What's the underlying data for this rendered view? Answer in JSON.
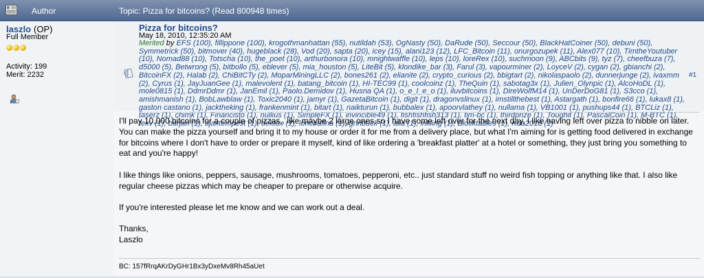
{
  "header": {
    "author_label": "Author",
    "topic_text": "Topic: Pizza for bitcoins?  (Read 800948 times)"
  },
  "user": {
    "name": "laszlo",
    "op": "(OP)",
    "rank": "Full Member",
    "activity": "Activity: 199",
    "merit": "Merit: 2232"
  },
  "post": {
    "title": "Pizza for bitcoins?",
    "date": "May 18, 2010, 12:35:20 AM",
    "merited_label": "Merited",
    "by_label": "by",
    "merits_rest": "EFS (100), fillippone (100), krogothmanhattan (55), nutildah (53), OgNasty (50), DaRude (50), Seccour (50), BlackHatCoiner (50), debuni (50), Symmetrick (50), bitmover (40), hugeblack (28), Vod (20), sapta (20), icey (15), alani123 (12), LFC_Bitcoin (11), onurgozupek (11), Alex077 (10), TimtheYoutuber (10), Nomad88 (10), Totscha (10), the_poet (10), arthurbonora (10), mnightwaffle (10), leps (10), loreRex (10), suchmoon (9), ABCbits (9), tyz (7), cheefbuza (7), d5000 (5), Betwrong (5), bitbollo (5), eblever (5), mia_houston (5), LiteBit (5), klondike_bar (3), Farul (3), vapourminer (2), LoyceV (2), cygan (2), gbianchi (2), BitcoinFX (2), Halab (2), ChiBitCTy (2), MoparMiningLLC (2), bones261 (2), elianite (2), crypto_curious (2), bbigtart (2), nikolaspaolo (2), dunnerjunge (2), ivaxmm (2), Cyrus (1), JayJuanGee (1), malevolent (1), batang_bitcoin (1), HI-TEC99 (1), coolcoinz (1), TheQuin (1), sabotag3x (1), Julien_Olynpic (1), AlcoHoDL (1), mole0815 (1), DdmrDdmr (1), JanEmil (1), Paolo.Demidov (1), Husna QA (1), o_e_l_e_o (1), iluvbitcoins (1), DireWolfM14 (1), UnDerDoG81 (1), S3cco (1), amishmanish (1), BobLawblaw (1), Toxic2040 (1), jamyr (1), GazetaBitcoin (1), digit (1), dragonvslinux (1), imstillthebest (1), Astargath (1), bonfire66 (1), lukax8 (1), gaston castano (1), jacktheking (1), frankenmint (1), bitart (1), naikturun (1), bubbalex (1), apoorvlathey (1), nullama (1), VB1001 (1), pushups44 (1), BTCLiz (1), taserz (1), chimk (1), Financisto (1), nullius (1), SimpleFX (1), invincible49 (1), fishfishfish313 (1), tim-bc (1), thirdprize (1), Toughit (1), PascalCoin (1), M-BTC (1), texv (1), barjan (1), ajaxtempest (1), dektox (1), lonchafina (1), grinbuck (1), alia (1), inkling (1), Blocktables (1), Kda2018 (1)",
    "number": "#1",
    "body": [
      "I'll pay 10,000 bitcoins for a couple of pizzas.. like maybe 2 large ones so I have some left over for the next day.  I like having left over pizza to nibble on later.  You can make the pizza yourself and bring it to my house or order it for me from a delivery place, but what I'm aiming for is getting food delivered in exchange for bitcoins where I don't have to order or prepare it myself, kind of like ordering a 'breakfast platter' at a hotel or something, they just bring you something to eat and you're happy!",
      "I like things like onions, peppers, sausage, mushrooms, tomatoes, pepperoni, etc.. just standard stuff no weird fish topping or anything like that.  I also like regular cheese pizzas which may be cheaper to prepare or otherwise acquire.",
      "If you're interested please let me know and we can work out a deal.",
      "Thanks,",
      "Laszlo"
    ],
    "signature": "BC: 157fRrqAKrDyGHr1Bx3yDxeMv8Rh45aUet"
  },
  "icons": {
    "header": "document-icon",
    "user": "person-icon",
    "post": "post-icon",
    "stars": "star-icon"
  },
  "colors": {
    "header_bg": "#5d7598",
    "link": "#224b8a",
    "merited_green": "#2c7a2c",
    "panel_bg": "#eef2f5"
  }
}
